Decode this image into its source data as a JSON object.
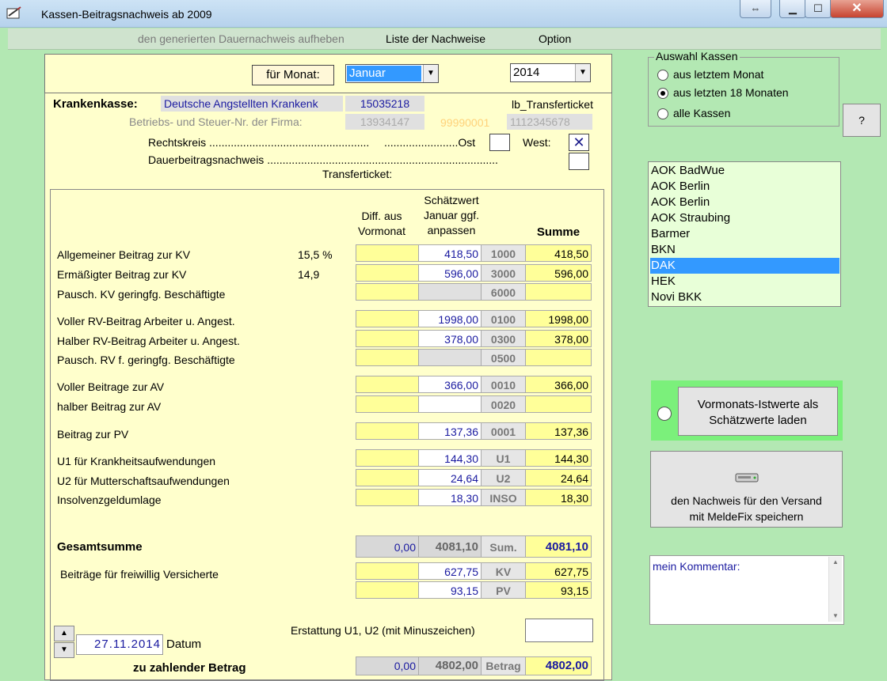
{
  "window": {
    "title": "Kassen-Beitragsnachweis ab 2009",
    "extra_button": "⇔",
    "minimize": "▁",
    "maximize": "☐",
    "close": "✕"
  },
  "menu": [
    "den generierten Dauernachweis aufheben",
    "Liste der Nachweise",
    "Option"
  ],
  "header": {
    "month_label": "für Monat:",
    "month_value": "Januar",
    "year_value": "2014"
  },
  "kasse": {
    "label": "Krankenkasse:",
    "name": "Deutsche Angstellten Krankenk",
    "number": "15035218",
    "transfer_ticket": "lb_Transferticket",
    "firm_label": "Betriebs- und Steuer-Nr. der Firma:",
    "firm_nr1": "13934147",
    "firm_nr2": "99990001",
    "firm_nr3": "1112345678",
    "rechtskreis_label": "Rechtskreis ....................................................",
    "ost_label": "........................Ost",
    "west_label": "West:",
    "west_checked": "✕",
    "dauer_label": "Dauerbeitragsnachweis ...........................................................................",
    "transferticket_label": "Transferticket:"
  },
  "columns": {
    "diff": "Diff. aus\nVormonat",
    "est": "Schätzwert\nJanuar ggf.\nanpassen",
    "sum": "Summe"
  },
  "rows": [
    {
      "label": "Allgemeiner Beitrag zur KV",
      "rate": "15,5 %",
      "diff": "",
      "est": "418,50",
      "code": "1000",
      "sum": "418,50"
    },
    {
      "label": "Ermäßigter Beitrag zur KV",
      "rate": "14,9",
      "diff": "",
      "est": "596,00",
      "code": "3000",
      "sum": "596,00"
    },
    {
      "label": "Pausch. KV geringfg. Beschäftigte",
      "rate": "",
      "diff": "",
      "est": "",
      "code": "6000",
      "sum": ""
    },
    {
      "label": "Voller RV-Beitrag Arbeiter u. Angest.",
      "rate": "",
      "diff": "",
      "est": "1998,00",
      "code": "0100",
      "sum": "1998,00"
    },
    {
      "label": "Halber RV-Beitrag Arbeiter u. Angest.",
      "rate": "",
      "diff": "",
      "est": "378,00",
      "code": "0300",
      "sum": "378,00"
    },
    {
      "label": "Pausch. RV f. geringfg. Beschäftigte",
      "rate": "",
      "diff": "",
      "est": "",
      "code": "0500",
      "sum": ""
    },
    {
      "label": "Voller Beitrage zur AV",
      "rate": "",
      "diff": "",
      "est": "366,00",
      "code": "0010",
      "sum": "366,00"
    },
    {
      "label": "halber Beitrag zur AV",
      "rate": "",
      "diff": "",
      "est": "",
      "code": "0020",
      "sum": ""
    },
    {
      "label": "Beitrag zur PV",
      "rate": "",
      "diff": "",
      "est": "137,36",
      "code": "0001",
      "sum": "137,36"
    },
    {
      "label": "U1 für Krankheitsaufwendungen",
      "rate": "",
      "diff": "",
      "est": "144,30",
      "code": "U1",
      "sum": "144,30"
    },
    {
      "label": "U2 für Mutterschaftsaufwendungen",
      "rate": "",
      "diff": "",
      "est": "24,64",
      "code": "U2",
      "sum": "24,64"
    },
    {
      "label": "Insolvenzgeldumlage",
      "rate": "",
      "diff": "",
      "est": "18,30",
      "code": "INSO",
      "sum": "18,30"
    }
  ],
  "total": {
    "label": "Gesamtsumme",
    "diff": "0,00",
    "est": "4081,10",
    "code": "Sum.",
    "sum": "4081,10"
  },
  "freiwillig": {
    "label": "Beiträge für freiwillig  Versicherte",
    "kv_est": "627,75",
    "kv_code": "KV",
    "kv_sum": "627,75",
    "pv_est": "93,15",
    "pv_code": "PV",
    "pv_sum": "93,15"
  },
  "erstattung_label": "Erstattung U1, U2 (mit Minuszeichen)",
  "date": {
    "value": "27.11.2014",
    "label": "Datum"
  },
  "zahlbetrag": {
    "label": "zu zahlender Betrag",
    "diff": "0,00",
    "est": "4802,00",
    "code": "Betrag",
    "sum": "4802,00"
  },
  "kassen_auswahl": {
    "title": "Auswahl Kassen",
    "options": [
      "aus letztem Monat",
      "aus letzten 18 Monaten",
      "alle Kassen"
    ],
    "selected": 1,
    "help": "?"
  },
  "kassen_list": [
    "AOK BadWue",
    "AOK Berlin",
    "AOK Berlin",
    "AOK Straubing",
    "Barmer",
    "BKN",
    "DAK",
    "HEK",
    "Novi BKK"
  ],
  "kassen_selected": 6,
  "load_button": "Vormonats-Istwerte als\nSchätzwerte laden",
  "save_button": "den Nachweis für den Versand\nmit MeldeFix speichern",
  "comment_label": "mein Kommentar:"
}
